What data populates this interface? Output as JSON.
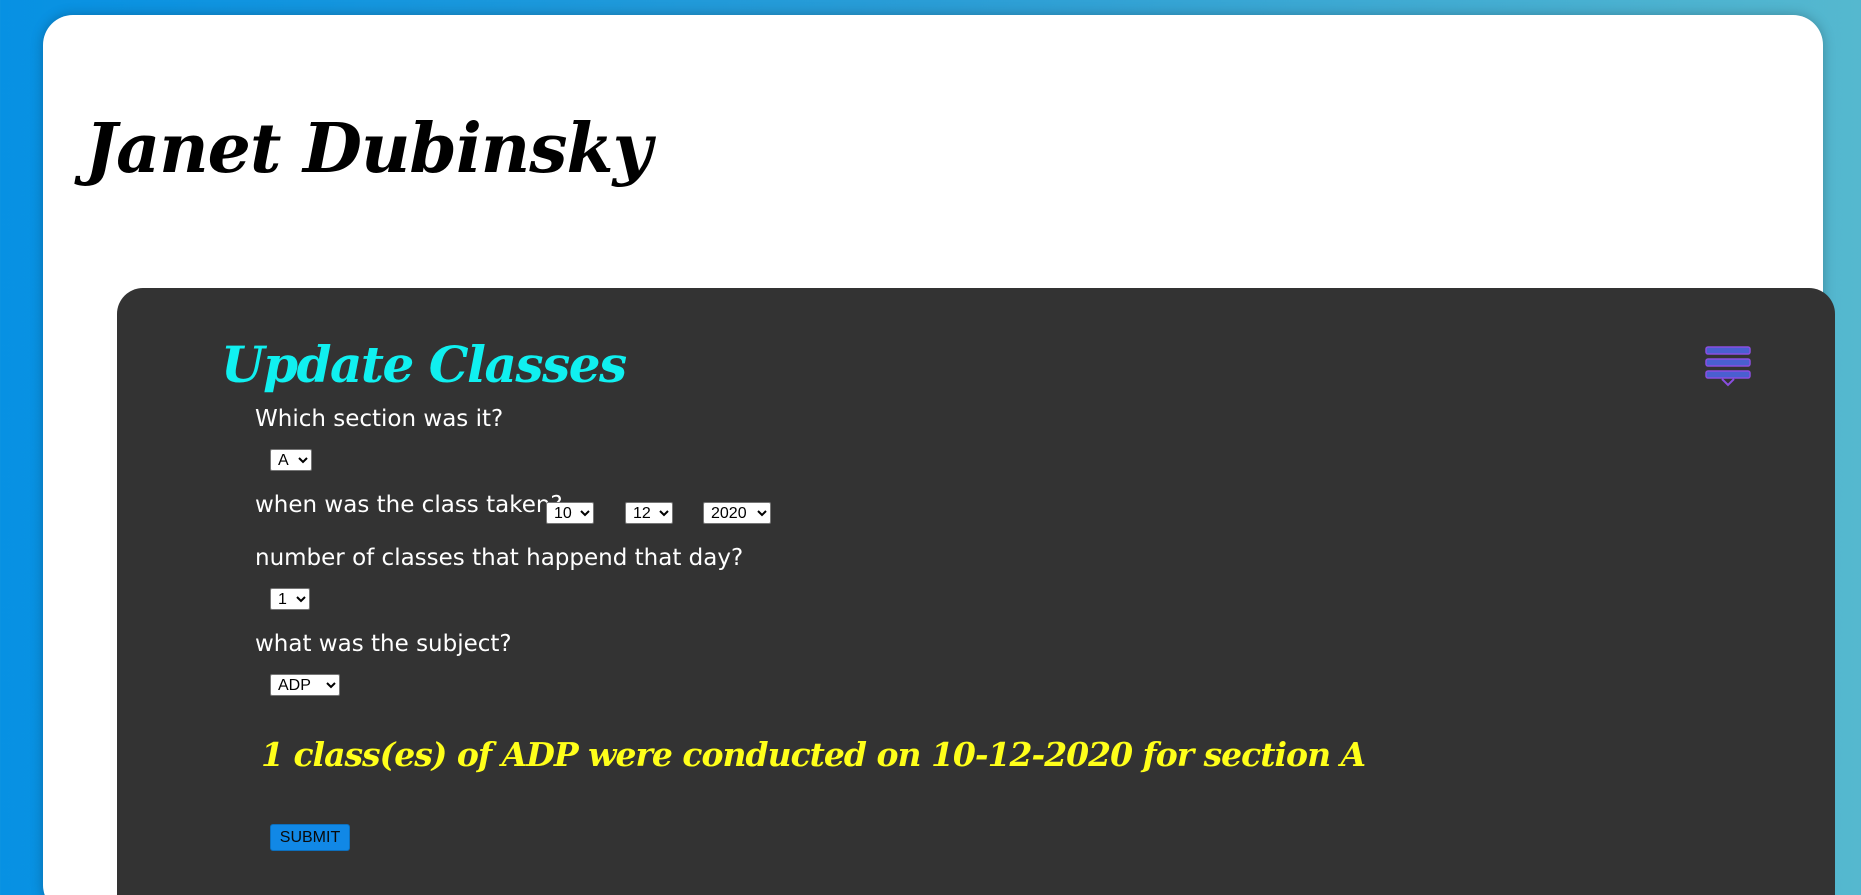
{
  "header": {
    "owner_name": "Janet Dubinsky"
  },
  "panel": {
    "title": "Update Classes",
    "menu_icon": "stacked-lines-menu-icon",
    "title_color": "#10f0f0",
    "summary_color": "#ffff1a",
    "accent_color": "#1188e6"
  },
  "form": {
    "section_question": "Which section was it?",
    "section_value": "A",
    "date_question": "when was the class taken?",
    "day_value": "10",
    "month_value": "12",
    "year_value": "2020",
    "count_question": "number of classes that happend that day?",
    "count_value": "1",
    "subject_question": "what was the subject?",
    "subject_value": "ADP",
    "summary": "1 class(es) of ADP were conducted on 10-12-2020 for section A",
    "submit_label": "SUBMIT"
  }
}
